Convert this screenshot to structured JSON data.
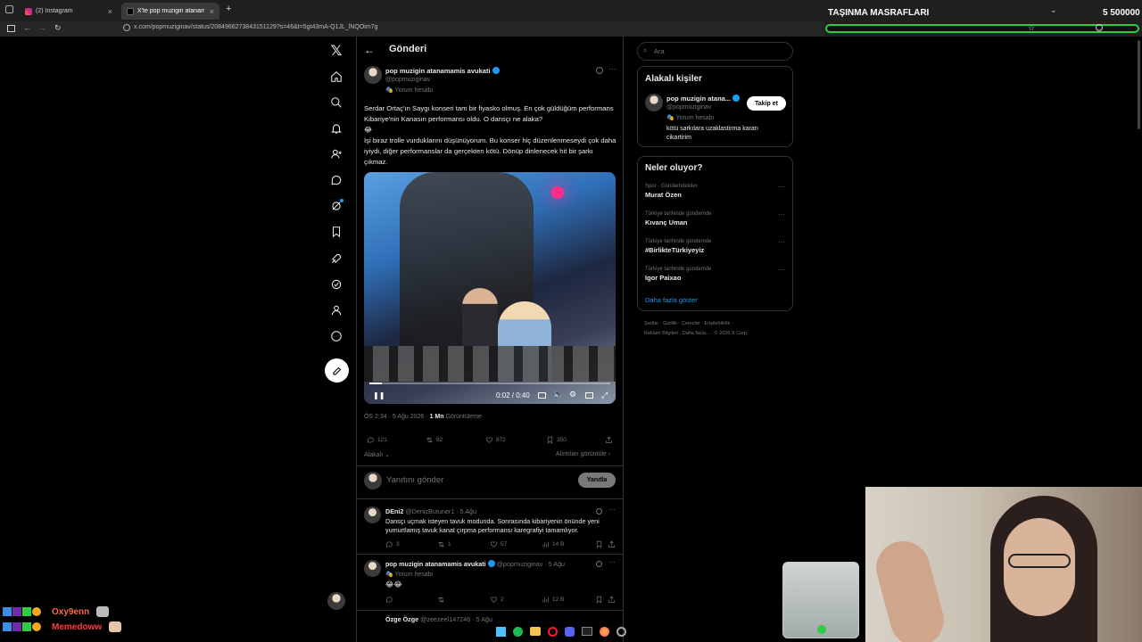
{
  "browser": {
    "tabs": [
      {
        "label": "(2) Instagram",
        "active": false
      },
      {
        "label": "X'te pop muzigin atanamamis avukati",
        "active": true
      }
    ],
    "url": "x.com/popmuziginav/status/2084966273843151129?s=46&t=5gt43mA-Q1JL_lNQOim7g"
  },
  "overlay": {
    "title": "TAŞINMA MASRAFLARI",
    "counter": "5 500000",
    "chat": [
      {
        "user": "Oxy9enn",
        "color": "#ff6a3d"
      },
      {
        "user": "Memedoww",
        "color": "#ff3b3b"
      }
    ]
  },
  "nav": {
    "items": [
      "x-logo-icon",
      "home-icon",
      "search-icon",
      "bell-icon",
      "people-icon",
      "message-icon",
      "grok-icon",
      "bookmark-icon",
      "rocket-icon",
      "verified-icon",
      "profile-icon",
      "more-icon"
    ]
  },
  "header": {
    "back": "←",
    "title": "Gönderi"
  },
  "post": {
    "name": "pop muzigin atanamamis avukati",
    "handle": "@popmuziginav",
    "parody": "Yorum hesabı",
    "text1": "Serdar Ortaç'ın Saygı konseri tam bir fiyasko olmuş. En çok güldüğüm performans Kibariye'nin Kanasın performansı oldu. O dansçı ne alaka?",
    "emoji1": "😂",
    "text2": "İşi biraz trolle vurduklarını düşünüyorum. Bu konser hiç düzenlenmeseydi çok daha iyiydi, diğer performanslar da gerçekten kötü. Dönüp dinlenecek hit bir şarkı çıkmaz.",
    "video_time": "0:02 / 0:40",
    "video_progress": 0.05,
    "timestamp": "ÖS 2:34 · 5 Ağu 2026 · ",
    "views": "1 Mn",
    "views_label": " Görüntüleme",
    "replies": "121",
    "reposts": "92",
    "likes": "872",
    "bookmarks": "350",
    "related": "Alakalı",
    "quotes": "Alıntıları görüntüle",
    "reply_placeholder": "Yanıtını gönder",
    "reply_button": "Yanıtla"
  },
  "replies": [
    {
      "name": "DEni2",
      "handle": "@DenizButuner1 · 5 Ağu",
      "text": "Dansçı uçmak isteyen tavuk modunda. Sonrasında kibariyenin önünde yeni yumurtlamış tavuk kanat çırpma performansı karegrafiyi tamamlıyor.",
      "replies": "3",
      "reposts": "1",
      "likes": "57",
      "views": "14 B"
    },
    {
      "name": "pop muzigin atanamamis avukati",
      "handle": "@popmuziginav · 5 Ağu",
      "parody": "Yorum hesabı",
      "text": "😂😂",
      "replies": "",
      "reposts": "",
      "likes": "2",
      "views": "12 B"
    },
    {
      "name": "Özge Özge",
      "handle": "@zeezeel147246 · 5 Ağu"
    }
  ],
  "sidebar": {
    "search_placeholder": "Ara",
    "people_title": "Alakalı kişiler",
    "person": {
      "name": "pop muzigin atana...",
      "handle": "@popmuziginav",
      "parody": "Yorum hesabı",
      "bio": "kötü sarkılara uzaklastirma kararı cikartirim",
      "follow": "Takip et"
    },
    "trends_title": "Neler oluyor?",
    "trends": [
      {
        "category": "Spor · Gündemdekiler",
        "name": "Murat Özen"
      },
      {
        "category": "Türkiye tarihinde gündemde",
        "name": "Kıvanç Uman"
      },
      {
        "category": "Türkiye tarihinde gündemde",
        "name": "#BirlikteTürkiyeyiz"
      },
      {
        "category": "Türkiye tarihinde gündemde",
        "name": "Igor Paixao"
      }
    ],
    "show_more": "Daha fazla göster",
    "footer1": "Şartlar · Gizlilik · Çerezler · Erişilebilirlik ·",
    "footer2": "Reklam Bilgileri · Daha fazla... · © 2026 X Corp."
  },
  "colors": {
    "accent": "#1d9bf0",
    "border": "#2f3336",
    "muted": "#71767b",
    "overlay_bar": "#2ecc40"
  }
}
